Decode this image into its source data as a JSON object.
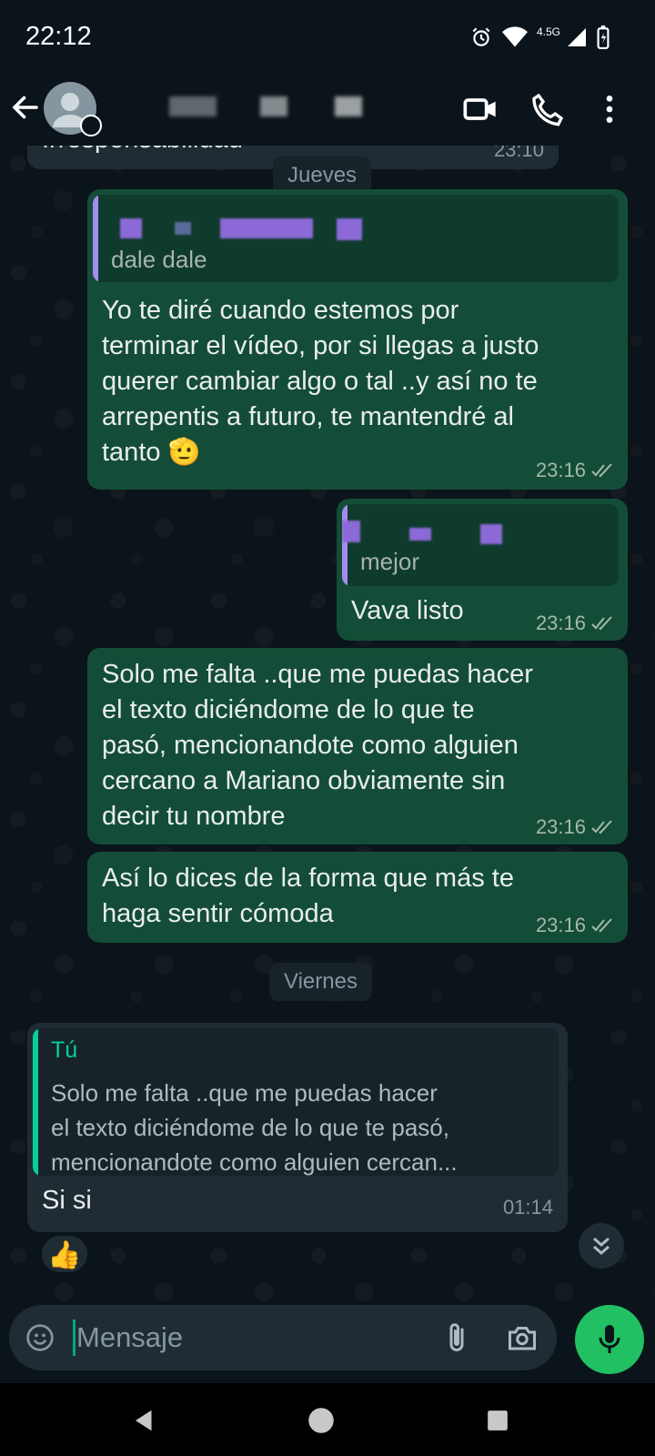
{
  "status_bar": {
    "time": "22:12",
    "network": "4.5G"
  },
  "header": {
    "icons": [
      "back-arrow-icon",
      "video-call-icon",
      "voice-call-icon",
      "more-options-icon"
    ]
  },
  "chat": {
    "prev_message": {
      "text": "Irresponsabilidad",
      "time": "23:10"
    },
    "date_1": "Jueves",
    "msg1": {
      "quote_text": "dale dale",
      "lines": [
        "Yo te diré cuando estemos por",
        "terminar el vídeo, por si llegas a justo",
        "querer cambiar algo o tal ..y así no te",
        "arrepentis a futuro, te mantendré al",
        "tanto"
      ],
      "emoji": "🫡",
      "time": "23:16"
    },
    "msg2": {
      "quote_text": "mejor",
      "text": "Vava listo",
      "time": "23:16"
    },
    "msg3": {
      "lines": [
        "Solo me falta ..que me puedas hacer",
        "el texto diciéndome de lo que te",
        "pasó, mencionandote como alguien",
        "cercano a Mariano obviamente sin",
        "decir tu nombre"
      ],
      "time": "23:16"
    },
    "msg4": {
      "lines": [
        "Así lo dices de la forma que más te",
        "haga sentir cómoda"
      ],
      "time": "23:16"
    },
    "date_2": "Viernes",
    "msg5": {
      "quote_name": "Tú",
      "quote_lines": [
        "Solo me falta ..que me puedas hacer",
        "el texto diciéndome de lo que te pasó,",
        "mencionandote como alguien cercan..."
      ],
      "text": "Si si",
      "time": "01:14"
    },
    "reaction": "👍"
  },
  "composer": {
    "placeholder": "Mensaje"
  },
  "colors": {
    "outgoing": "#144d37",
    "incoming": "#1f2c34",
    "accent": "#21c063",
    "background": "#0b141a"
  }
}
